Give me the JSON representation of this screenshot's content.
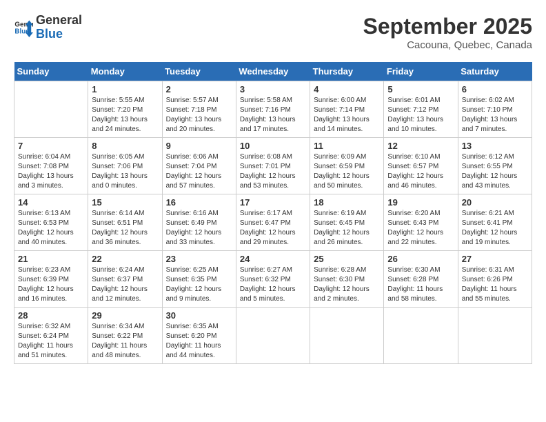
{
  "header": {
    "logo_line1": "General",
    "logo_line2": "Blue",
    "month": "September 2025",
    "location": "Cacouna, Quebec, Canada"
  },
  "days_of_week": [
    "Sunday",
    "Monday",
    "Tuesday",
    "Wednesday",
    "Thursday",
    "Friday",
    "Saturday"
  ],
  "weeks": [
    [
      {
        "day": "",
        "info": ""
      },
      {
        "day": "1",
        "info": "Sunrise: 5:55 AM\nSunset: 7:20 PM\nDaylight: 13 hours\nand 24 minutes."
      },
      {
        "day": "2",
        "info": "Sunrise: 5:57 AM\nSunset: 7:18 PM\nDaylight: 13 hours\nand 20 minutes."
      },
      {
        "day": "3",
        "info": "Sunrise: 5:58 AM\nSunset: 7:16 PM\nDaylight: 13 hours\nand 17 minutes."
      },
      {
        "day": "4",
        "info": "Sunrise: 6:00 AM\nSunset: 7:14 PM\nDaylight: 13 hours\nand 14 minutes."
      },
      {
        "day": "5",
        "info": "Sunrise: 6:01 AM\nSunset: 7:12 PM\nDaylight: 13 hours\nand 10 minutes."
      },
      {
        "day": "6",
        "info": "Sunrise: 6:02 AM\nSunset: 7:10 PM\nDaylight: 13 hours\nand 7 minutes."
      }
    ],
    [
      {
        "day": "7",
        "info": "Sunrise: 6:04 AM\nSunset: 7:08 PM\nDaylight: 13 hours\nand 3 minutes."
      },
      {
        "day": "8",
        "info": "Sunrise: 6:05 AM\nSunset: 7:06 PM\nDaylight: 13 hours\nand 0 minutes."
      },
      {
        "day": "9",
        "info": "Sunrise: 6:06 AM\nSunset: 7:04 PM\nDaylight: 12 hours\nand 57 minutes."
      },
      {
        "day": "10",
        "info": "Sunrise: 6:08 AM\nSunset: 7:01 PM\nDaylight: 12 hours\nand 53 minutes."
      },
      {
        "day": "11",
        "info": "Sunrise: 6:09 AM\nSunset: 6:59 PM\nDaylight: 12 hours\nand 50 minutes."
      },
      {
        "day": "12",
        "info": "Sunrise: 6:10 AM\nSunset: 6:57 PM\nDaylight: 12 hours\nand 46 minutes."
      },
      {
        "day": "13",
        "info": "Sunrise: 6:12 AM\nSunset: 6:55 PM\nDaylight: 12 hours\nand 43 minutes."
      }
    ],
    [
      {
        "day": "14",
        "info": "Sunrise: 6:13 AM\nSunset: 6:53 PM\nDaylight: 12 hours\nand 40 minutes."
      },
      {
        "day": "15",
        "info": "Sunrise: 6:14 AM\nSunset: 6:51 PM\nDaylight: 12 hours\nand 36 minutes."
      },
      {
        "day": "16",
        "info": "Sunrise: 6:16 AM\nSunset: 6:49 PM\nDaylight: 12 hours\nand 33 minutes."
      },
      {
        "day": "17",
        "info": "Sunrise: 6:17 AM\nSunset: 6:47 PM\nDaylight: 12 hours\nand 29 minutes."
      },
      {
        "day": "18",
        "info": "Sunrise: 6:19 AM\nSunset: 6:45 PM\nDaylight: 12 hours\nand 26 minutes."
      },
      {
        "day": "19",
        "info": "Sunrise: 6:20 AM\nSunset: 6:43 PM\nDaylight: 12 hours\nand 22 minutes."
      },
      {
        "day": "20",
        "info": "Sunrise: 6:21 AM\nSunset: 6:41 PM\nDaylight: 12 hours\nand 19 minutes."
      }
    ],
    [
      {
        "day": "21",
        "info": "Sunrise: 6:23 AM\nSunset: 6:39 PM\nDaylight: 12 hours\nand 16 minutes."
      },
      {
        "day": "22",
        "info": "Sunrise: 6:24 AM\nSunset: 6:37 PM\nDaylight: 12 hours\nand 12 minutes."
      },
      {
        "day": "23",
        "info": "Sunrise: 6:25 AM\nSunset: 6:35 PM\nDaylight: 12 hours\nand 9 minutes."
      },
      {
        "day": "24",
        "info": "Sunrise: 6:27 AM\nSunset: 6:32 PM\nDaylight: 12 hours\nand 5 minutes."
      },
      {
        "day": "25",
        "info": "Sunrise: 6:28 AM\nSunset: 6:30 PM\nDaylight: 12 hours\nand 2 minutes."
      },
      {
        "day": "26",
        "info": "Sunrise: 6:30 AM\nSunset: 6:28 PM\nDaylight: 11 hours\nand 58 minutes."
      },
      {
        "day": "27",
        "info": "Sunrise: 6:31 AM\nSunset: 6:26 PM\nDaylight: 11 hours\nand 55 minutes."
      }
    ],
    [
      {
        "day": "28",
        "info": "Sunrise: 6:32 AM\nSunset: 6:24 PM\nDaylight: 11 hours\nand 51 minutes."
      },
      {
        "day": "29",
        "info": "Sunrise: 6:34 AM\nSunset: 6:22 PM\nDaylight: 11 hours\nand 48 minutes."
      },
      {
        "day": "30",
        "info": "Sunrise: 6:35 AM\nSunset: 6:20 PM\nDaylight: 11 hours\nand 44 minutes."
      },
      {
        "day": "",
        "info": ""
      },
      {
        "day": "",
        "info": ""
      },
      {
        "day": "",
        "info": ""
      },
      {
        "day": "",
        "info": ""
      }
    ]
  ]
}
